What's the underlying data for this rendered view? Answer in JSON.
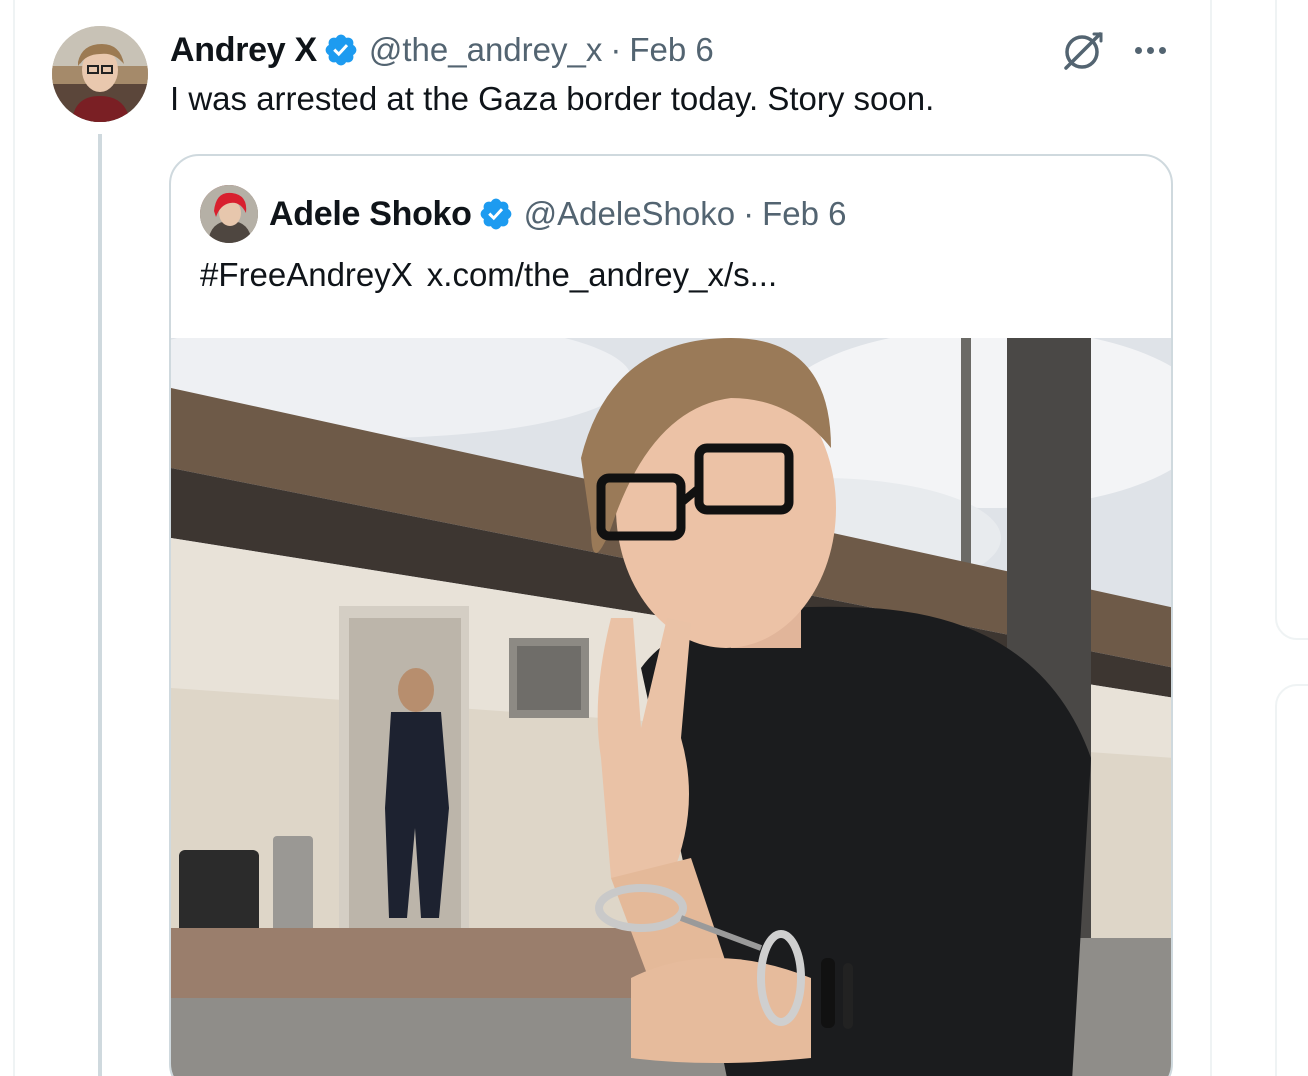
{
  "tweet": {
    "author_name": "Andrey X",
    "handle": "@the_andrey_x",
    "separator": "·",
    "date": "Feb 6",
    "text": "I was arrested at the Gaza border today. Story soon.",
    "verified_icon": "verified-badge-icon",
    "grok_icon": "grok-icon",
    "more_icon": "more-options-icon"
  },
  "quoted_tweet": {
    "author_name": "Adele Shoko",
    "handle": "@AdeleShoko",
    "separator": "·",
    "date": "Feb 6",
    "hashtag": "#FreeAndreyX",
    "link_text": "x.com/the_andrey_x/s...",
    "verified_icon": "verified-badge-icon",
    "media": "photo-man-in-handcuffs-peace-sign"
  },
  "colors": {
    "text_primary": "#0f1419",
    "text_secondary": "#536471",
    "verified_blue": "#1d9bf0",
    "border": "#cfd9de"
  }
}
